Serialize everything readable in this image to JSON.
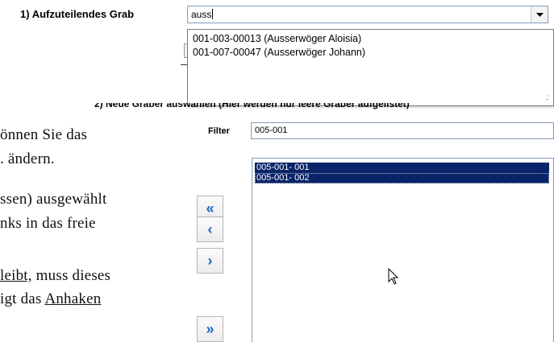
{
  "document": {
    "lines": [
      {
        "text": "önnen Sie das"
      },
      {
        "text": ". ändern."
      },
      {
        "text": "ssen) ausgewählt"
      },
      {
        "text": "nks in das freie"
      },
      {
        "underlined": "leibt,",
        "rest": " muss dieses"
      },
      {
        "text": "igt das ",
        "underlined": "Anhaken"
      }
    ]
  },
  "step1": {
    "label": "1) Aufzuteilendes Grab",
    "input_value": "auss",
    "dropdown_items": [
      "001-003-00013 (Ausserwöger Aloisia)",
      "001-007-00047 (Ausserwöger Johann)"
    ]
  },
  "step2": {
    "label": "2) Neue Gräber auswählen (Hier werden nur leere Gräber aufgelistet)"
  },
  "filter": {
    "label": "Filter",
    "value": "005-001"
  },
  "list": {
    "items": [
      "005-001- 001",
      "005-001- 002"
    ]
  },
  "buttons": {
    "move_all_left": "«",
    "move_left": "‹",
    "move_right": "›",
    "move_all_right": "»"
  },
  "colors": {
    "selection": "#0a246a",
    "arrow": "#1f64c8",
    "border": "#7f9db9"
  },
  "icons": {
    "dropdown": "chevron-down-icon",
    "cursor": "mouse-pointer-icon"
  }
}
